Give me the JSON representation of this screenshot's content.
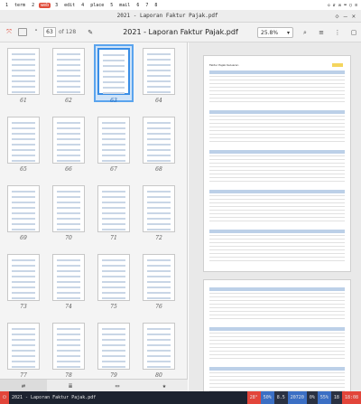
{
  "topbar": {
    "workspaces": [
      "1",
      "term",
      "2",
      "web",
      "3",
      "edit",
      "4",
      "place",
      "5",
      "mail",
      "6",
      "7",
      "8"
    ],
    "active_workspace": "web",
    "tray": [
      "◇",
      "⇵",
      "✉",
      "⌨",
      "○",
      "≡"
    ]
  },
  "window": {
    "title": "2021 - Laporan Faktur Pajak.pdf",
    "controls": [
      "◇",
      "—",
      "✕"
    ]
  },
  "toolbar": {
    "current_page": "63",
    "of_pages": "of 128",
    "doc_title": "2021 - Laporan Faktur Pajak.pdf",
    "zoom": "25.8%",
    "icons": [
      "sidebar-toggle-icon",
      "up-icon",
      "down-icon",
      "pencil-icon",
      "search-icon",
      "menu-icon",
      "kebab-icon"
    ]
  },
  "thumbnails": [
    {
      "num": "61"
    },
    {
      "num": "62"
    },
    {
      "num": "63"
    },
    {
      "num": "64"
    },
    {
      "num": "65"
    },
    {
      "num": "66"
    },
    {
      "num": "67"
    },
    {
      "num": "68"
    },
    {
      "num": "69"
    },
    {
      "num": "70"
    },
    {
      "num": "71"
    },
    {
      "num": "72"
    },
    {
      "num": "73"
    },
    {
      "num": "74"
    },
    {
      "num": "75"
    },
    {
      "num": "76"
    },
    {
      "num": "77"
    },
    {
      "num": "78"
    },
    {
      "num": "79"
    },
    {
      "num": "80"
    }
  ],
  "selected_page": "63",
  "sidebar_tabs": [
    "⇄",
    "≣",
    "▭",
    "★"
  ],
  "main_pages": [
    {
      "title": "Faktur Pajak Keluaran",
      "badge": "Mei 2021"
    },
    {
      "title": "",
      "badge": ""
    }
  ],
  "taskbar": {
    "left": "⏻",
    "title": "2021 - Laporan Faktur Pajak.pdf",
    "segments": [
      "28°",
      "50%",
      "8.5",
      "20720",
      "0%",
      "55%",
      "18",
      "18:08",
      "28.1",
      "26°"
    ]
  },
  "colors": {
    "accent": "#3a8ee6",
    "taskbar": "#1d2330",
    "active_ws": "#e04c3a"
  }
}
